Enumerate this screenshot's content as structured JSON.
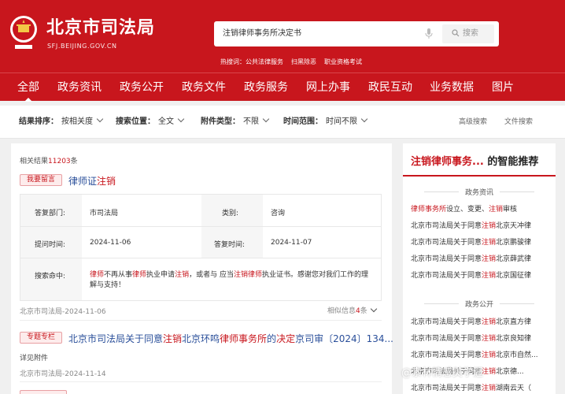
{
  "header": {
    "title": "北京市司法局",
    "url": "SFJ.BEIJING.GOV.CN",
    "search_value": "注销律师事务所决定书",
    "search_button": "搜索",
    "hot_label": "热搜词：",
    "hot_words": [
      "公共法律服务",
      "扫黑除恶",
      "职业资格考试"
    ]
  },
  "nav": {
    "items": [
      "全部",
      "政务资讯",
      "政务公开",
      "政务文件",
      "政务服务",
      "网上办事",
      "政民互动",
      "业务数据",
      "图片"
    ],
    "active": 0
  },
  "filters": {
    "sort_label": "结果排序：",
    "sort_value": "按相关度",
    "position_label": "搜索位置：",
    "position_value": "全文",
    "type_label": "附件类型：",
    "type_value": "不限",
    "time_label": "时间范围：",
    "time_value": "时间不限",
    "advanced": "高级搜索",
    "file_search": "文件搜索"
  },
  "results": {
    "count_prefix": "相关结果",
    "count": "11203",
    "count_suffix": "条",
    "r1": {
      "tag": "我要留言",
      "title_a": "律师证",
      "title_b": "注销",
      "dept_label": "答复部门:",
      "dept": "市司法局",
      "cat_label": "类别:",
      "cat": "咨询",
      "ask_label": "提问时间:",
      "ask_time": "2024-11-06",
      "reply_label": "答复时间:",
      "reply_time": "2024-11-07",
      "cmd_label": "搜索命中:",
      "reply_parts": [
        "律师",
        "不再从事",
        "律师",
        "执业申请",
        "注销",
        "，或者与 应当",
        "注销律师",
        "执业证书。感谢您对我们工作的理解与支持！"
      ],
      "source": "北京市司法局-2024-11-06",
      "related_prefix": "相似信息",
      "related_num": "4",
      "related_suffix": "条"
    },
    "r2": {
      "tag": "专题专栏",
      "title_parts": [
        "北京市司法局关于同意",
        "注销",
        "北京环鸣",
        "律师事务所",
        "的",
        "决定",
        "京司审〔2024〕134..."
      ],
      "attach": "详见附件",
      "source": "北京市司法局-2024-11-14"
    }
  },
  "sidebar": {
    "title_hl": "注销律师事务...",
    "title_rest": "的智能推荐",
    "sec1": "政务资讯",
    "items1": [
      [
        "律师事务所",
        "设立、变更、",
        "注销",
        "审核"
      ],
      [
        "北京市司法局关于同意",
        "注销",
        "北京天冲律"
      ],
      [
        "北京市司法局关于同意",
        "注销",
        "北京鹏骏律"
      ],
      [
        "北京市司法局关于同意",
        "注销",
        "北京薛武律"
      ],
      [
        "北京市司法局关于同意",
        "注销",
        "北京国征律"
      ]
    ],
    "sec2": "政务公开",
    "items2": [
      [
        "北京市司法局关于同意",
        "注销",
        "北京直方律"
      ],
      [
        "北京市司法局关于同意",
        "注销",
        "北京良知律"
      ],
      [
        "北京市司法局关于同意",
        "注销",
        "北京市自然..."
      ],
      [
        "北京市司法局关于同意",
        "注销",
        "北京德..."
      ],
      [
        "北京市司法局关于同意",
        "注销",
        "湖南云天（"
      ]
    ]
  },
  "watermark": "@索林情感美学涯",
  "colors": {
    "brand": "#c8161d",
    "link": "#2a4f9a"
  }
}
